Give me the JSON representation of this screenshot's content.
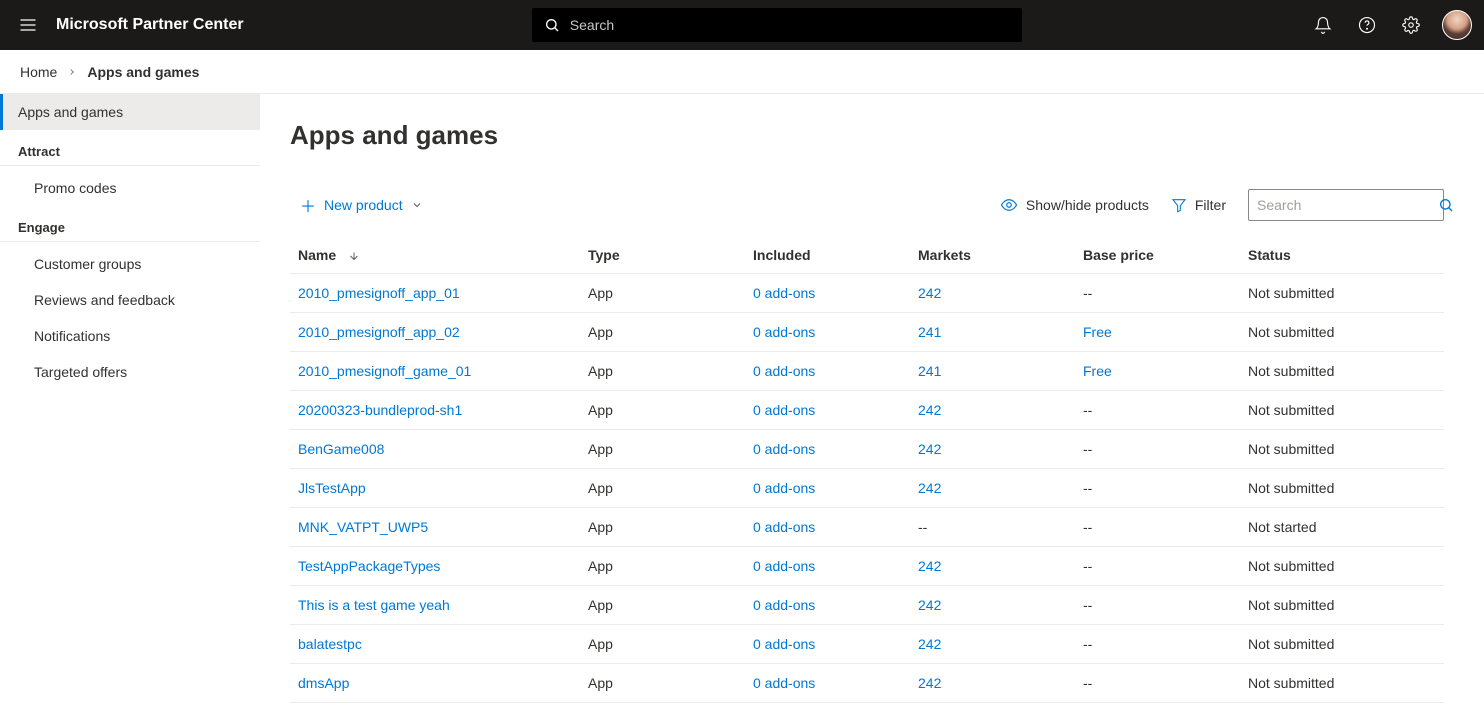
{
  "header": {
    "brand": "Microsoft Partner Center",
    "search_placeholder": "Search"
  },
  "breadcrumb": {
    "items": [
      {
        "label": "Home",
        "current": false
      },
      {
        "label": "Apps and games",
        "current": true
      }
    ]
  },
  "sidebar": {
    "top_item": "Apps and games",
    "groups": [
      {
        "label": "Attract",
        "items": [
          {
            "label": "Promo codes"
          }
        ]
      },
      {
        "label": "Engage",
        "items": [
          {
            "label": "Customer groups"
          },
          {
            "label": "Reviews and feedback"
          },
          {
            "label": "Notifications"
          },
          {
            "label": "Targeted offers"
          }
        ]
      }
    ]
  },
  "main": {
    "title": "Apps and games",
    "new_product_label": "New product",
    "show_hide_label": "Show/hide products",
    "filter_label": "Filter",
    "table_search_placeholder": "Search",
    "columns": {
      "name": "Name",
      "type": "Type",
      "included": "Included",
      "markets": "Markets",
      "baseprice": "Base price",
      "status": "Status"
    },
    "rows": [
      {
        "name": "2010_pmesignoff_app_01",
        "type": "App",
        "included": "0 add-ons",
        "markets": "242",
        "baseprice": "--",
        "status": "Not submitted"
      },
      {
        "name": "2010_pmesignoff_app_02",
        "type": "App",
        "included": "0 add-ons",
        "markets": "241",
        "baseprice": "Free",
        "status": "Not submitted"
      },
      {
        "name": "2010_pmesignoff_game_01",
        "type": "App",
        "included": "0 add-ons",
        "markets": "241",
        "baseprice": "Free",
        "status": "Not submitted"
      },
      {
        "name": "20200323-bundleprod-sh1",
        "type": "App",
        "included": "0 add-ons",
        "markets": "242",
        "baseprice": "--",
        "status": "Not submitted"
      },
      {
        "name": "BenGame008",
        "type": "App",
        "included": "0 add-ons",
        "markets": "242",
        "baseprice": "--",
        "status": "Not submitted"
      },
      {
        "name": "JlsTestApp",
        "type": "App",
        "included": "0 add-ons",
        "markets": "242",
        "baseprice": "--",
        "status": "Not submitted"
      },
      {
        "name": "MNK_VATPT_UWP5",
        "type": "App",
        "included": "0 add-ons",
        "markets": "--",
        "baseprice": "--",
        "status": "Not started"
      },
      {
        "name": "TestAppPackageTypes",
        "type": "App",
        "included": "0 add-ons",
        "markets": "242",
        "baseprice": "--",
        "status": "Not submitted"
      },
      {
        "name": "This is a test game yeah",
        "type": "App",
        "included": "0 add-ons",
        "markets": "242",
        "baseprice": "--",
        "status": "Not submitted"
      },
      {
        "name": "balatestpc",
        "type": "App",
        "included": "0 add-ons",
        "markets": "242",
        "baseprice": "--",
        "status": "Not submitted"
      },
      {
        "name": "dmsApp",
        "type": "App",
        "included": "0 add-ons",
        "markets": "242",
        "baseprice": "--",
        "status": "Not submitted"
      }
    ]
  }
}
